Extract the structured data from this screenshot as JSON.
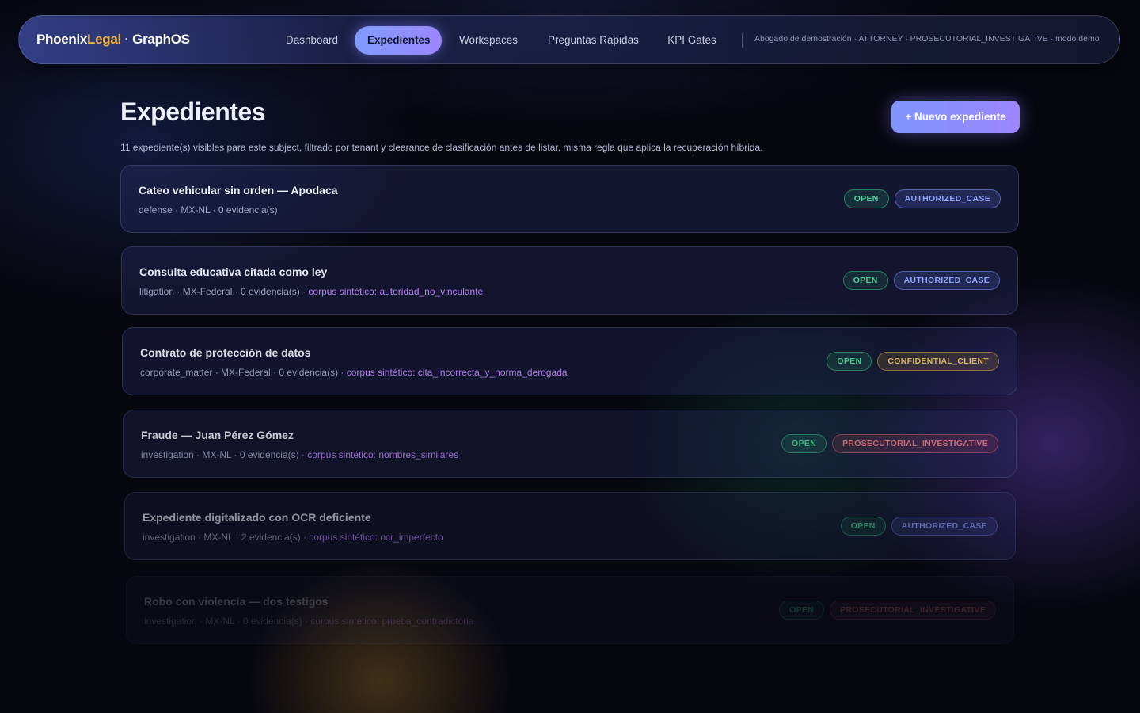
{
  "brand": {
    "part1": "Phoenix",
    "part2": "Legal",
    "dot": " · ",
    "part3": "GraphOS"
  },
  "nav": {
    "items": [
      {
        "label": "Dashboard"
      },
      {
        "label": "Expedientes"
      },
      {
        "label": "Workspaces"
      },
      {
        "label": "Preguntas Rápidas"
      },
      {
        "label": "KPI Gates"
      }
    ],
    "active_index": 1,
    "session": "Abogado de demostración · ATTORNEY · PROSECUTORIAL_INVESTIGATIVE · modo demo"
  },
  "page": {
    "title": "Expedientes",
    "new_button": "+ Nuevo expediente",
    "subtitle": "11 expediente(s) visibles para este subject, filtrado por tenant y clearance de clasificación antes de listar, misma regla que aplica la recuperación híbrida."
  },
  "cases": [
    {
      "title": "Cateo vehicular sin orden — Apodaca",
      "meta": "defense · MX-NL · 0 evidencia(s)",
      "corpus": "",
      "status": "OPEN",
      "classification": "AUTHORIZED_CASE"
    },
    {
      "title": "Consulta educativa citada como ley",
      "meta": "litigation · MX-Federal · 0 evidencia(s)",
      "corpus": " · corpus sintético: autoridad_no_vinculante",
      "status": "OPEN",
      "classification": "AUTHORIZED_CASE"
    },
    {
      "title": "Contrato de protección de datos",
      "meta": "corporate_matter · MX-Federal · 0 evidencia(s)",
      "corpus": " · corpus sintético: cita_incorrecta_y_norma_derogada",
      "status": "OPEN",
      "classification": "CONFIDENTIAL_CLIENT"
    },
    {
      "title": "Fraude — Juan Pérez Gómez",
      "meta": "investigation · MX-NL · 0 evidencia(s)",
      "corpus": " · corpus sintético: nombres_similares",
      "status": "OPEN",
      "classification": "PROSECUTORIAL_INVESTIGATIVE"
    },
    {
      "title": "Expediente digitalizado con OCR deficiente",
      "meta": "investigation · MX-NL · 2 evidencia(s)",
      "corpus": " · corpus sintético: ocr_imperfecto",
      "status": "OPEN",
      "classification": "AUTHORIZED_CASE"
    },
    {
      "title": "Robo con violencia — dos testigos",
      "meta": "investigation · MX-NL · 0 evidencia(s)",
      "corpus": " · corpus sintético: prueba_contradictoria",
      "status": "OPEN",
      "classification": "PROSECUTORIAL_INVESTIGATIVE"
    }
  ],
  "colors": {
    "accent": "#8b91ff",
    "open": "#52d39e",
    "authorized": "#93a6ff",
    "confidential": "#e7bf6e",
    "prosecutorial": "#ee7e86",
    "corpus": "#b685f4"
  }
}
